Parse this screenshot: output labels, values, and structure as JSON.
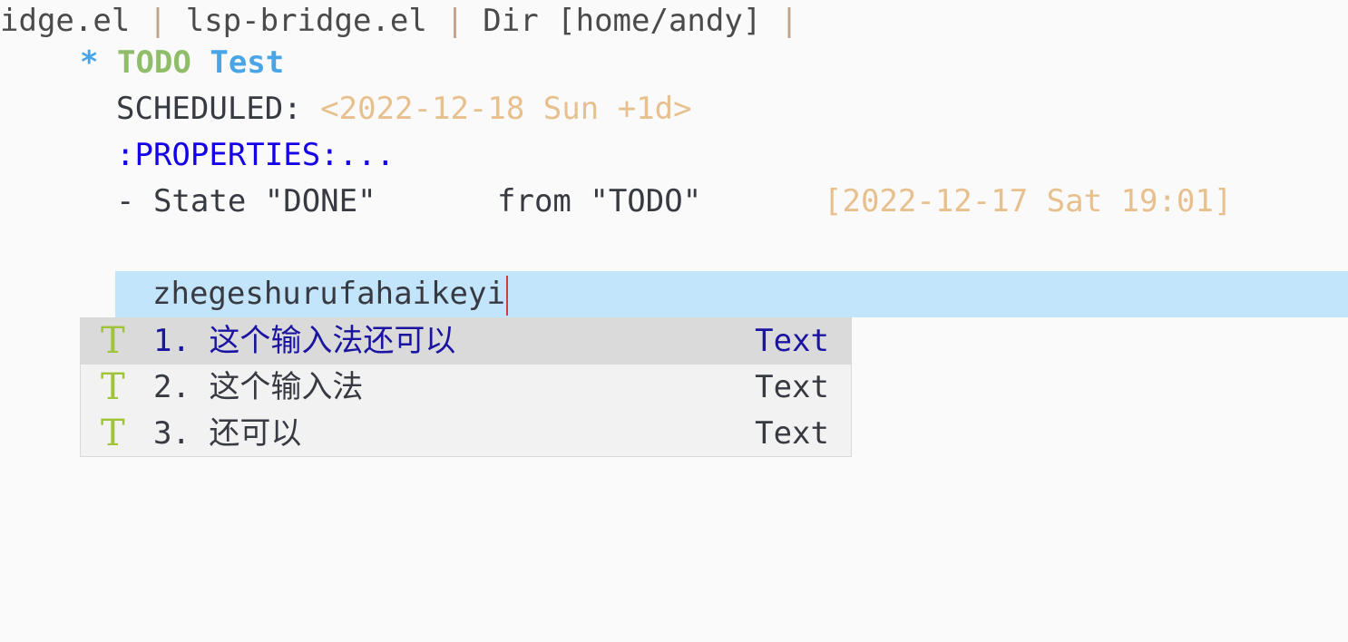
{
  "header": {
    "segments": [
      "idge.el ",
      " lsp-bridge.el ",
      " Dir [home/andy] "
    ],
    "separator": "|"
  },
  "heading": {
    "star": "*",
    "keyword": "TODO",
    "title": "Test"
  },
  "scheduled": {
    "label": "SCHEDULED: ",
    "timestamp": "<2022-12-18 Sun +1d>"
  },
  "properties": ":PROPERTIES:...",
  "state_log": {
    "state": "- State \"DONE\"",
    "from": "from \"TODO\"",
    "timestamp": "[2022-12-17 Sat 19:01]"
  },
  "input": {
    "text": "zhegeshurufahaikeyi"
  },
  "completion": {
    "items": [
      {
        "icon": "T",
        "label": "1. 这个输入法还可以",
        "kind": "Text",
        "selected": true
      },
      {
        "icon": "T",
        "label": "2. 这个输入法",
        "kind": "Text",
        "selected": false
      },
      {
        "icon": "T",
        "label": "3. 还可以",
        "kind": "Text",
        "selected": false
      }
    ]
  },
  "colors": {
    "background": "#fafafa",
    "heading_blue": "#4aa5e6",
    "todo_green": "#8fbd6a",
    "timestamp": "#e7c08e",
    "properties": "#1500e6",
    "input_highlight": "#c3e5fb",
    "selected_candidate": "#1a14a0",
    "icon_green": "#9fc43a"
  }
}
